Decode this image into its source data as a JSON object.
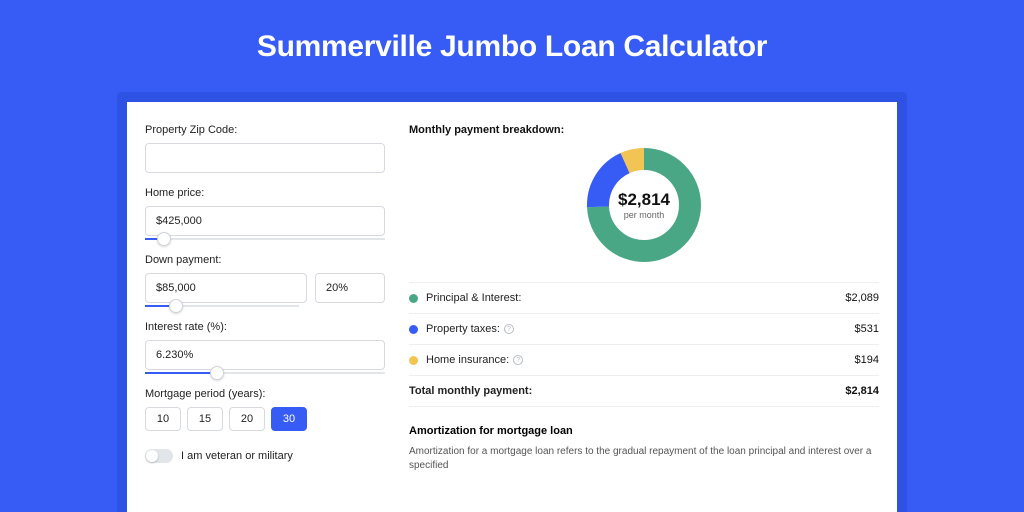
{
  "title": "Summerville Jumbo Loan Calculator",
  "form": {
    "zip_label": "Property Zip Code:",
    "zip_value": "",
    "home_price_label": "Home price:",
    "home_price_value": "$425,000",
    "home_price_slider_pct": 8,
    "down_payment_label": "Down payment:",
    "down_payment_value": "$85,000",
    "down_payment_pct": "20%",
    "down_payment_slider_pct": 20,
    "interest_label": "Interest rate (%):",
    "interest_value": "6.230%",
    "interest_slider_pct": 30,
    "period_label": "Mortgage period (years):",
    "period_options": [
      "10",
      "15",
      "20",
      "30"
    ],
    "period_active": "30",
    "veteran_label": "I am veteran or military"
  },
  "breakdown": {
    "heading": "Monthly payment breakdown:",
    "center_value": "$2,814",
    "center_sub": "per month",
    "items": [
      {
        "label": "Principal & Interest:",
        "amount": "$2,089",
        "color": "#4aa785",
        "value": 2089,
        "info": false
      },
      {
        "label": "Property taxes:",
        "amount": "$531",
        "color": "#365cf5",
        "value": 531,
        "info": true
      },
      {
        "label": "Home insurance:",
        "amount": "$194",
        "color": "#f1c453",
        "value": 194,
        "info": true
      }
    ],
    "total_label": "Total monthly payment:",
    "total_amount": "$2,814"
  },
  "amort": {
    "heading": "Amortization for mortgage loan",
    "text": "Amortization for a mortgage loan refers to the gradual repayment of the loan principal and interest over a specified"
  },
  "chart_data": {
    "type": "pie",
    "title": "Monthly payment breakdown",
    "categories": [
      "Principal & Interest",
      "Property taxes",
      "Home insurance"
    ],
    "values": [
      2089,
      531,
      194
    ],
    "colors": [
      "#4aa785",
      "#365cf5",
      "#f1c453"
    ],
    "total": 2814
  }
}
